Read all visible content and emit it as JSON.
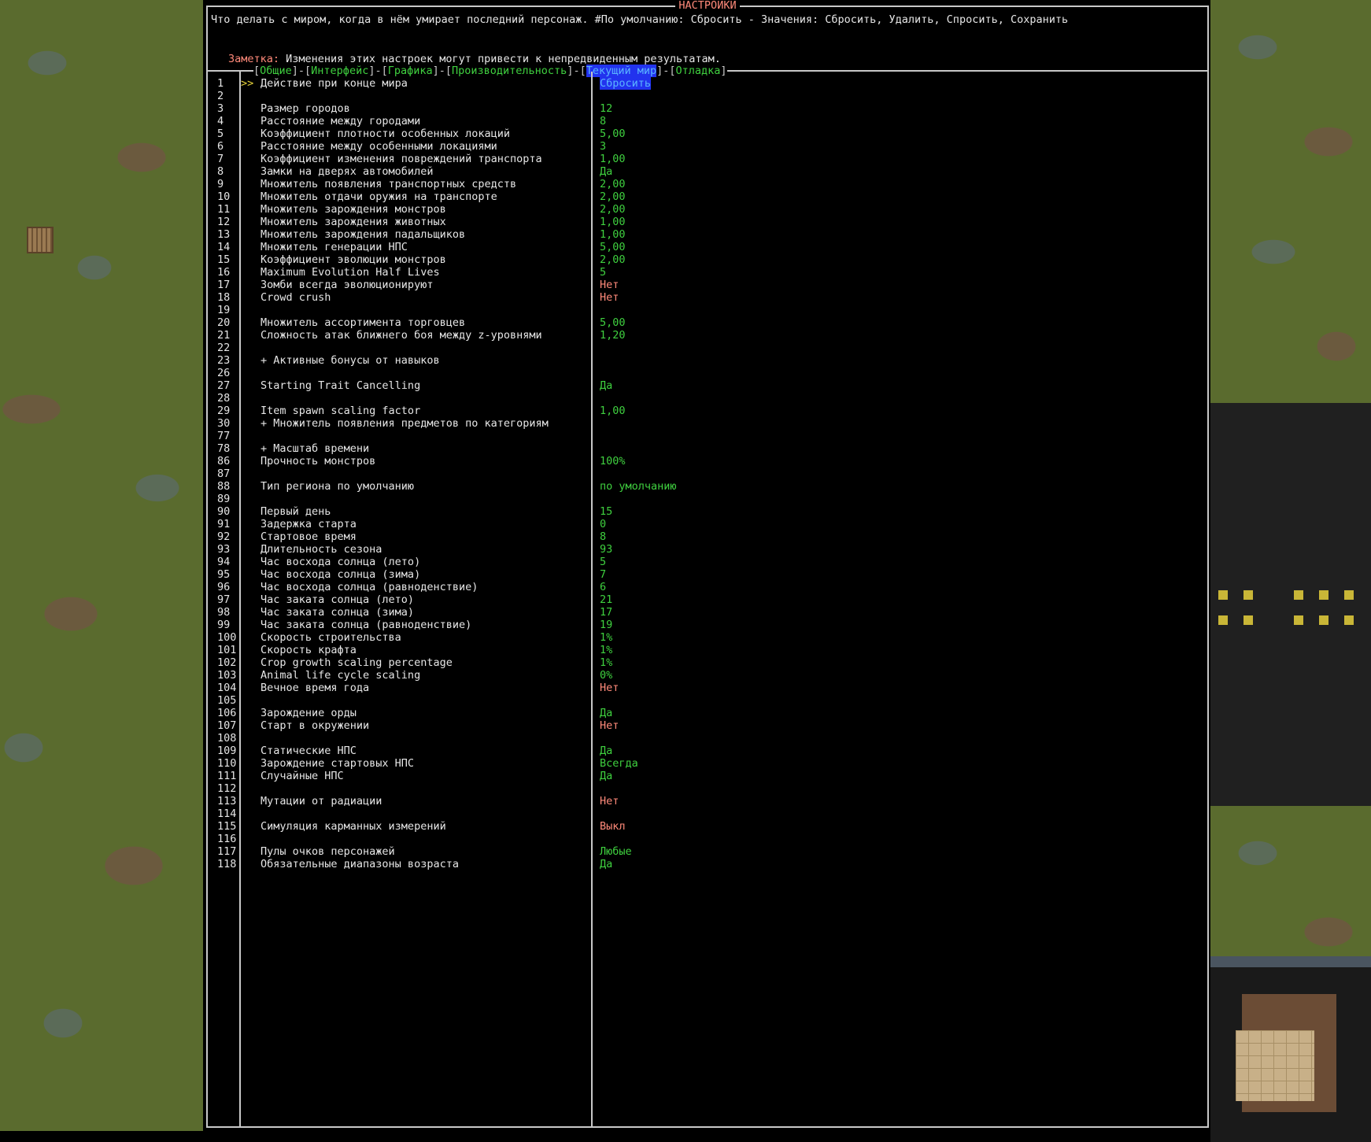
{
  "window": {
    "title": "НАСТРОЙКИ"
  },
  "description": "Что делать с миром, когда в нём умирает последний персонаж. #По умолчанию: Сбросить - Значения: Сбросить, Удалить, Спросить, Сохранить",
  "note": {
    "label": "Заметка:",
    "text": " Изменения этих настроек могут привести к непредвиденным результатам."
  },
  "tabs": [
    {
      "label": "Общие",
      "active": false
    },
    {
      "label": "Интерфейс",
      "active": false
    },
    {
      "label": "Графика",
      "active": false
    },
    {
      "label": "Производительность",
      "active": false
    },
    {
      "label": "Текущий мир",
      "active": true
    },
    {
      "label": "Отладка",
      "active": false
    }
  ],
  "cursor": ">>",
  "rows": [
    {
      "n": "1",
      "label": "Действие при конце мира",
      "value": "Сбросить",
      "color": "blue",
      "selected": true
    },
    {
      "n": "2",
      "label": "",
      "value": "",
      "color": "green"
    },
    {
      "n": "3",
      "label": "Размер городов",
      "value": "12",
      "color": "green"
    },
    {
      "n": "4",
      "label": "Расстояние между городами",
      "value": "8",
      "color": "green"
    },
    {
      "n": "5",
      "label": "Коэффициент плотности особенных локаций",
      "value": "5,00",
      "color": "green"
    },
    {
      "n": "6",
      "label": "Расстояние между особенными локациями",
      "value": "3",
      "color": "green"
    },
    {
      "n": "7",
      "label": "Коэффициент изменения повреждений транспорта",
      "value": "1,00",
      "color": "green"
    },
    {
      "n": "8",
      "label": "Замки на дверях автомобилей",
      "value": "Да",
      "color": "green"
    },
    {
      "n": "9",
      "label": "Множитель появления транспортных средств",
      "value": "2,00",
      "color": "green"
    },
    {
      "n": "10",
      "label": "Множитель отдачи оружия на транспорте",
      "value": "2,00",
      "color": "green"
    },
    {
      "n": "11",
      "label": "Множитель зарождения монстров",
      "value": "2,00",
      "color": "green"
    },
    {
      "n": "12",
      "label": "Множитель зарождения животных",
      "value": "1,00",
      "color": "green"
    },
    {
      "n": "13",
      "label": "Множитель зарождения падальщиков",
      "value": "1,00",
      "color": "green"
    },
    {
      "n": "14",
      "label": "Множитель генерации НПС",
      "value": "5,00",
      "color": "green"
    },
    {
      "n": "15",
      "label": "Коэффициент эволюции монстров",
      "value": "2,00",
      "color": "green"
    },
    {
      "n": "16",
      "label": "Maximum Evolution Half Lives",
      "value": "5",
      "color": "green"
    },
    {
      "n": "17",
      "label": "Зомби всегда эволюционируют",
      "value": "Нет",
      "color": "red"
    },
    {
      "n": "18",
      "label": "Crowd crush",
      "value": "Нет",
      "color": "red"
    },
    {
      "n": "19",
      "label": "",
      "value": "",
      "color": "green"
    },
    {
      "n": "20",
      "label": "Множитель ассортимента торговцев",
      "value": "5,00",
      "color": "green"
    },
    {
      "n": "21",
      "label": "Сложность атак ближнего боя между z-уровнями",
      "value": "1,20",
      "color": "green"
    },
    {
      "n": "22",
      "label": "",
      "value": "",
      "color": "green"
    },
    {
      "n": "23",
      "label": "+ Активные бонусы от навыков",
      "value": "",
      "color": "green"
    },
    {
      "n": "26",
      "label": "",
      "value": "",
      "color": "green"
    },
    {
      "n": "27",
      "label": "Starting Trait Cancelling",
      "value": "Да",
      "color": "green"
    },
    {
      "n": "28",
      "label": "",
      "value": "",
      "color": "green"
    },
    {
      "n": "29",
      "label": "Item spawn scaling factor",
      "value": "1,00",
      "color": "green"
    },
    {
      "n": "30",
      "label": "+ Множитель появления предметов по категориям",
      "value": "",
      "color": "green"
    },
    {
      "n": "77",
      "label": "",
      "value": "",
      "color": "green"
    },
    {
      "n": "78",
      "label": "+ Масштаб времени",
      "value": "",
      "color": "green"
    },
    {
      "n": "86",
      "label": "Прочность монстров",
      "value": "100%",
      "color": "green"
    },
    {
      "n": "87",
      "label": "",
      "value": "",
      "color": "green"
    },
    {
      "n": "88",
      "label": "Тип региона по умолчанию",
      "value": "по умолчанию",
      "color": "green"
    },
    {
      "n": "89",
      "label": "",
      "value": "",
      "color": "green"
    },
    {
      "n": "90",
      "label": "Первый день",
      "value": "15",
      "color": "green"
    },
    {
      "n": "91",
      "label": "Задержка старта",
      "value": "0",
      "color": "green"
    },
    {
      "n": "92",
      "label": "Стартовое время",
      "value": "8",
      "color": "green"
    },
    {
      "n": "93",
      "label": "Длительность сезона",
      "value": "93",
      "color": "green"
    },
    {
      "n": "94",
      "label": "Час восхода солнца (лето)",
      "value": "5",
      "color": "green"
    },
    {
      "n": "95",
      "label": "Час восхода солнца (зима)",
      "value": "7",
      "color": "green"
    },
    {
      "n": "96",
      "label": "Час восхода солнца (равноденствие)",
      "value": "6",
      "color": "green"
    },
    {
      "n": "97",
      "label": "Час заката солнца (лето)",
      "value": "21",
      "color": "green"
    },
    {
      "n": "98",
      "label": "Час заката солнца (зима)",
      "value": "17",
      "color": "green"
    },
    {
      "n": "99",
      "label": "Час заката солнца (равноденствие)",
      "value": "19",
      "color": "green"
    },
    {
      "n": "100",
      "label": "Скорость строительства",
      "value": "1%",
      "color": "green"
    },
    {
      "n": "101",
      "label": "Скорость крафта",
      "value": "1%",
      "color": "green"
    },
    {
      "n": "102",
      "label": "Crop growth scaling percentage",
      "value": "1%",
      "color": "green"
    },
    {
      "n": "103",
      "label": "Animal life cycle scaling",
      "value": "0%",
      "color": "green"
    },
    {
      "n": "104",
      "label": "Вечное время года",
      "value": "Нет",
      "color": "red"
    },
    {
      "n": "105",
      "label": "",
      "value": "",
      "color": "green"
    },
    {
      "n": "106",
      "label": "Зарождение орды",
      "value": "Да",
      "color": "green"
    },
    {
      "n": "107",
      "label": "Старт в окружении",
      "value": "Нет",
      "color": "red"
    },
    {
      "n": "108",
      "label": "",
      "value": "",
      "color": "green"
    },
    {
      "n": "109",
      "label": "Статические НПС",
      "value": "Да",
      "color": "green"
    },
    {
      "n": "110",
      "label": "Зарождение стартовых НПС",
      "value": "Всегда",
      "color": "green"
    },
    {
      "n": "111",
      "label": "Случайные НПС",
      "value": "Да",
      "color": "green"
    },
    {
      "n": "112",
      "label": "",
      "value": "",
      "color": "green"
    },
    {
      "n": "113",
      "label": "Мутации от радиации",
      "value": "Нет",
      "color": "red"
    },
    {
      "n": "114",
      "label": "",
      "value": "",
      "color": "green"
    },
    {
      "n": "115",
      "label": "Симуляция карманных измерений",
      "value": "Выкл",
      "color": "red"
    },
    {
      "n": "116",
      "label": "",
      "value": "",
      "color": "green"
    },
    {
      "n": "117",
      "label": "Пулы очков персонажей",
      "value": "Любые",
      "color": "green"
    },
    {
      "n": "118",
      "label": "Обязательные диапазоны возраста",
      "value": "Да",
      "color": "green"
    }
  ]
}
